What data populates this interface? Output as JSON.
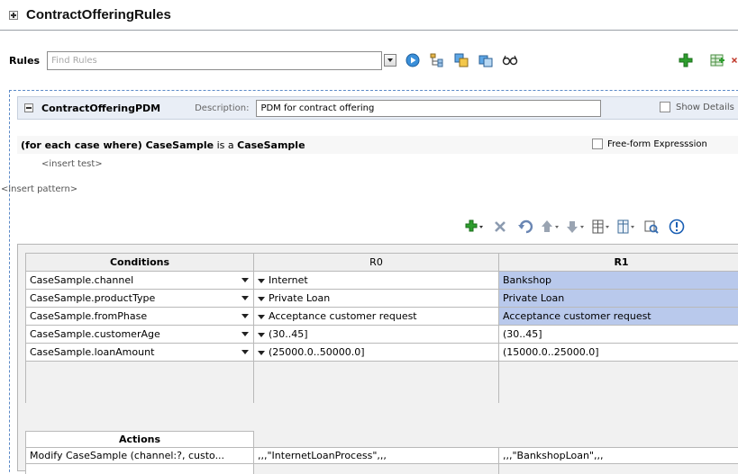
{
  "header": {
    "title": "ContractOfferingRules"
  },
  "rules_bar": {
    "label": "Rules",
    "search_placeholder": "Find Rules"
  },
  "ruleset": {
    "name": "ContractOfferingPDM",
    "description_label": "Description:",
    "description_value": "PDM for contract offering",
    "show_details_label": "Show Details"
  },
  "pattern": {
    "prefix": "(for each case where) ",
    "var": "CaseSample",
    "mid": " is a ",
    "type": "CaseSample",
    "freeform_label": "Free-form Expresssion",
    "insert_test": "<insert test>",
    "insert_pattern": "<insert pattern>"
  },
  "conditions": {
    "header": "Conditions",
    "col_r0": "R0",
    "col_r1": "R1",
    "rows": [
      {
        "name": "CaseSample.channel",
        "r0": "Internet",
        "r1": "Bankshop"
      },
      {
        "name": "CaseSample.productType",
        "r0": "Private Loan",
        "r1": "Private Loan"
      },
      {
        "name": "CaseSample.fromPhase",
        "r0": "Acceptance customer request",
        "r1": "Acceptance customer request"
      },
      {
        "name": "CaseSample.customerAge",
        "r0": "(30..45]",
        "r1": "(30..45]"
      },
      {
        "name": "CaseSample.loanAmount",
        "r0": "(25000.0..50000.0]",
        "r1": "(15000.0..25000.0]"
      }
    ]
  },
  "actions": {
    "header": "Actions",
    "rows": [
      {
        "name": "Modify CaseSample (channel:?, custo...",
        "r0": ",,,\"InternetLoanProcess\",,,",
        "r1": ",,,\"BankshopLoan\",,,"
      }
    ]
  },
  "colors": {
    "accent_blue": "#5b89c7",
    "highlight": "#b9c9ec",
    "add_green": "#2e9e2e",
    "delete_red": "#c0392b"
  }
}
